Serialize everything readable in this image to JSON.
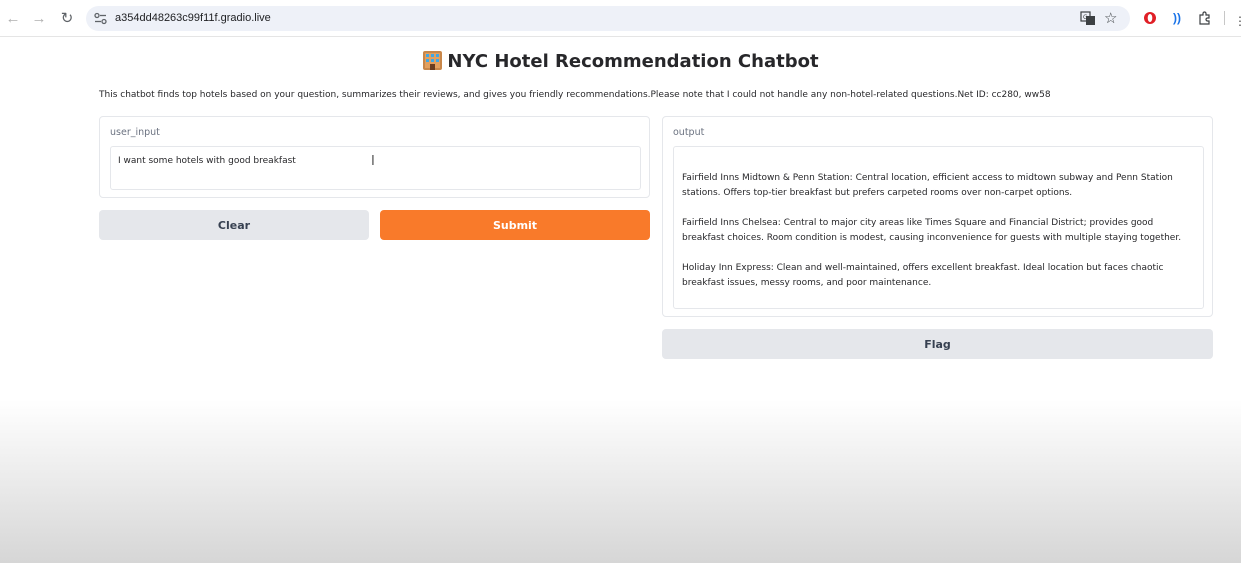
{
  "browser": {
    "url": "a354dd48263c99f11f.gradio.live"
  },
  "page": {
    "title": "NYC Hotel Recommendation Chatbot",
    "description": "This chatbot finds top hotels based on your question, summarizes their reviews, and gives you friendly recommendations.Please note that I could not handle any non-hotel-related questions.Net ID: cc280, ww58"
  },
  "input": {
    "label": "user_input",
    "value": "I want some hotels with good breakfast"
  },
  "buttons": {
    "clear": "Clear",
    "submit": "Submit",
    "flag": "Flag"
  },
  "output": {
    "label": "output",
    "paragraphs": [
      "Fairfield Inns Midtown & Penn Station: Central location, efficient access to midtown subway and Penn Station stations. Offers top-tier breakfast but prefers carpeted rooms over non-carpet options.",
      "Fairfield Inns Chelsea: Central to major city areas like Times Square and Financial District; provides good breakfast choices. Room condition is modest, causing inconvenience for guests with multiple staying together.",
      "Holiday Inn Express: Clean and well-maintained, offers excellent breakfast. Ideal location but faces chaotic breakfast issues, messy rooms, and poor maintenance."
    ]
  },
  "colors": {
    "submit": "#f97a2a",
    "secondary": "#e5e7eb"
  }
}
